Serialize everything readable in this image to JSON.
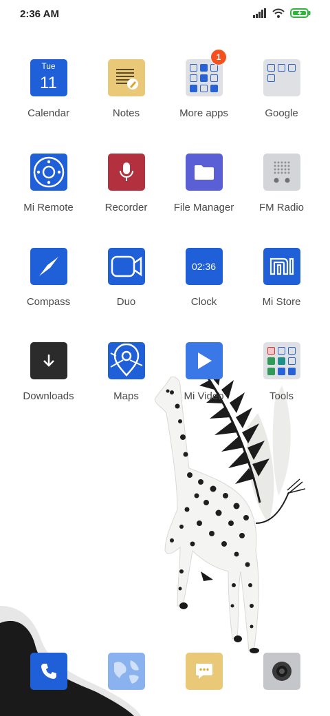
{
  "status_bar": {
    "time": "2:36 AM"
  },
  "apps": [
    {
      "name": "calendar-app",
      "label": "Calendar",
      "icon": "calendar-icon",
      "cal_day": "Tue",
      "cal_date": "11"
    },
    {
      "name": "notes-app",
      "label": "Notes",
      "icon": "notes-icon"
    },
    {
      "name": "more-apps-folder",
      "label": "More apps",
      "icon": "folder-icon",
      "badge": "1"
    },
    {
      "name": "google-folder",
      "label": "Google",
      "icon": "folder-icon"
    },
    {
      "name": "mi-remote-app",
      "label": "Mi Remote",
      "icon": "remote-icon"
    },
    {
      "name": "recorder-app",
      "label": "Recorder",
      "icon": "microphone-icon"
    },
    {
      "name": "file-manager-app",
      "label": "File Manager",
      "icon": "folder-icon"
    },
    {
      "name": "fm-radio-app",
      "label": "FM Radio",
      "icon": "radio-icon"
    },
    {
      "name": "compass-app",
      "label": "Compass",
      "icon": "compass-icon"
    },
    {
      "name": "duo-app",
      "label": "Duo",
      "icon": "video-camera-icon"
    },
    {
      "name": "clock-app",
      "label": "Clock",
      "icon": "clock-icon",
      "clock_time": "02:36"
    },
    {
      "name": "mi-store-app",
      "label": "Mi Store",
      "icon": "mi-logo-icon"
    },
    {
      "name": "downloads-app",
      "label": "Downloads",
      "icon": "download-icon"
    },
    {
      "name": "maps-app",
      "label": "Maps",
      "icon": "map-pin-icon"
    },
    {
      "name": "mi-video-app",
      "label": "Mi Video",
      "icon": "play-icon"
    },
    {
      "name": "tools-folder",
      "label": "Tools",
      "icon": "folder-icon"
    }
  ],
  "dock": [
    {
      "name": "phone-app",
      "icon": "phone-icon"
    },
    {
      "name": "browser-app",
      "icon": "globe-icon"
    },
    {
      "name": "messaging-app",
      "icon": "message-icon"
    },
    {
      "name": "camera-app",
      "icon": "camera-icon"
    }
  ],
  "colors": {
    "accent_blue": "#1f5fd8",
    "notes_yellow": "#e9c978",
    "recorder_red": "#b3313f",
    "file_manager_purple": "#5a5fd6",
    "badge_orange": "#f4511e"
  }
}
